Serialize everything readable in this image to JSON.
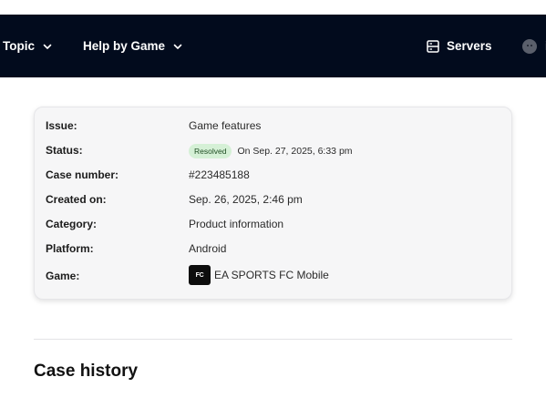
{
  "nav": {
    "topic_label": "Topic",
    "help_by_game_label": "Help by Game",
    "servers_label": "Servers",
    "account_label": "i"
  },
  "case": {
    "issue_label": "Issue:",
    "issue_value": "Game features",
    "status_label": "Status:",
    "status_badge": "Resolved",
    "status_date": "On Sep. 27, 2025, 6:33 pm",
    "case_number_label": "Case number:",
    "case_number_value": "#223485188",
    "created_label": "Created on:",
    "created_value": "Sep. 26, 2025, 2:46 pm",
    "category_label": "Category:",
    "category_value": "Product information",
    "platform_label": "Platform:",
    "platform_value": "Android",
    "game_label": "Game:",
    "game_value": "EA SPORTS FC Mobile",
    "game_icon": "fc-logo",
    "game_icon_text": "FC"
  },
  "history": {
    "title": "Case history"
  },
  "colors": {
    "nav_bg": "#020b1d",
    "badge_bg": "#d5f0d6",
    "card_bg": "#f6f6f7"
  }
}
